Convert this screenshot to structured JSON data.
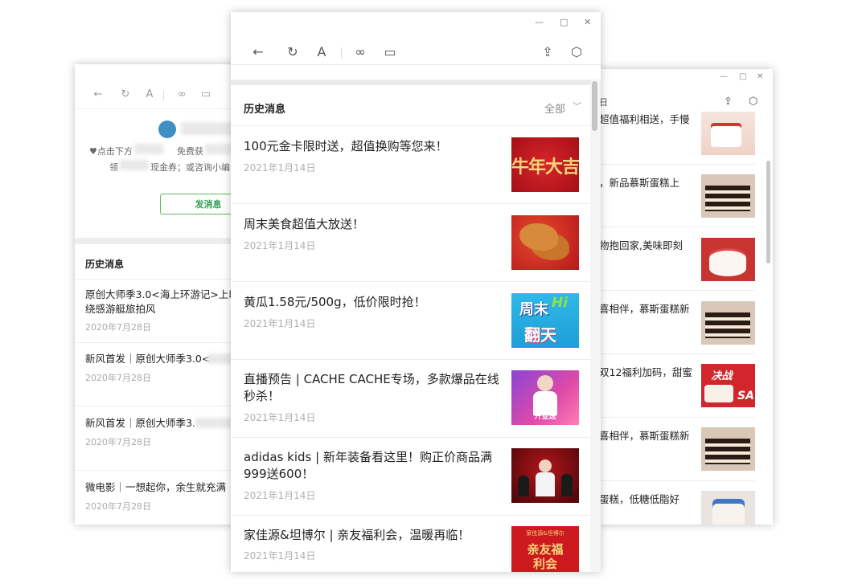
{
  "center": {
    "header": {
      "title": "历史消息",
      "filter": "全部"
    },
    "articles": [
      {
        "title": "100元金卡限时送，超值换购等您来！",
        "date": "2021年1月14日"
      },
      {
        "title": "周末美食超值大放送！",
        "date": "2021年1月14日"
      },
      {
        "title": "黄瓜1.58元/500g，低价限时抢！",
        "date": "2021年1月14日"
      },
      {
        "title": "直播预告 | CACHE CACHE专场，多款爆品在线秒杀！",
        "date": "2021年1月14日"
      },
      {
        "title": "adidas kids | 新年装备看这里！购正价商品满999送600！",
        "date": "2021年1月14日"
      },
      {
        "title": "家佳源&坦博尔 | 亲友福利会，温暖再临！",
        "date": "2021年1月14日"
      }
    ],
    "thumb_texts": [
      "牛年大吉",
      "周末",
      "翻天",
      "Hi",
      "开业送",
      "亲友福利会"
    ],
    "thumb_sub_texts": [
      "家佳源&坦博尔"
    ]
  },
  "left": {
    "intro_line1": "♥点击下方",
    "intro_line1b": "免费获",
    "intro_line2": "领",
    "intro_line2b": "现金券；或咨询小编",
    "send_button": "发消息",
    "header": "历史消息",
    "articles": [
      {
        "title_l1": "原创大师季3.0<海上环游记>上印",
        "title_l2": "绕感游艇旅拍风",
        "date": "2020年7月28日"
      },
      {
        "title_l1": "新风首发｜原创大师季3.0<",
        "date": "2020年7月28日"
      },
      {
        "title_l1": "新风首发｜原创大师季3.",
        "date": "2020年7月28日"
      },
      {
        "title_l1": "微电影｜一想起你，余生就充满",
        "date": "2020年7月28日"
      }
    ]
  },
  "right": {
    "partial_header": "日",
    "articles": [
      {
        "title": "超值福利相送，手慢"
      },
      {
        "title": "，新品慕斯蛋糕上"
      },
      {
        "title": "物抱回家,美味即刻"
      },
      {
        "title": "喜相伴，慕斯蛋糕新"
      },
      {
        "title": "双12福利加码，甜蜜"
      },
      {
        "title": "喜相伴，慕斯蛋糕新"
      },
      {
        "title": "蛋糕，低糖低脂好"
      }
    ],
    "thumb_texts": [
      "决战",
      "SA"
    ]
  },
  "colors": {
    "accent_green": "#2e9e4f",
    "festive_red": "#c8191f",
    "date_gray": "#b0b0b0"
  }
}
